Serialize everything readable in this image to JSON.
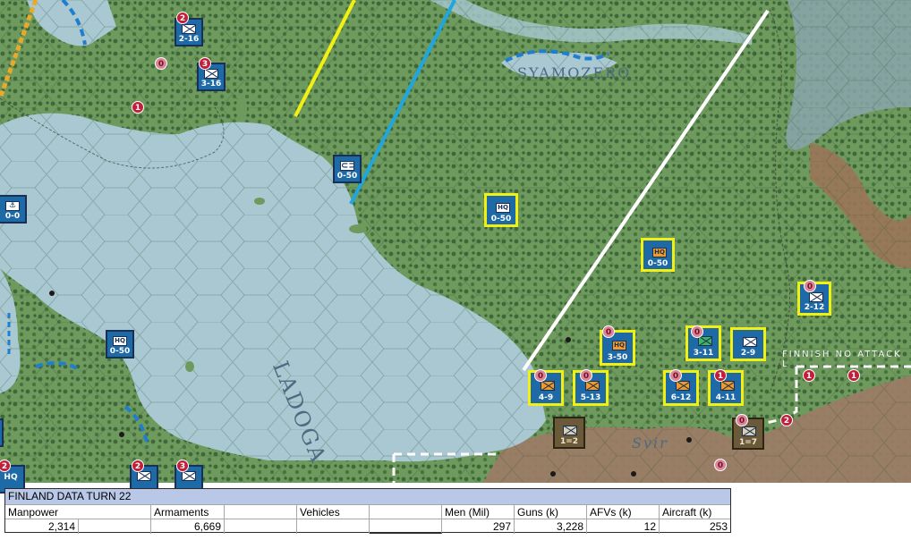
{
  "map": {
    "labels": {
      "lake": "LADOGA",
      "town": "SYAMOZERO",
      "river": "Svir",
      "zone": "FINNISH NO ATTACK L"
    },
    "colors": {
      "land": "#5f8f52",
      "forest": "#3e6d3a",
      "water": "#a9c8d2",
      "hills": "#9a7658",
      "front_yellow": "#f2ef12",
      "front_blue": "#1ea6e0",
      "front_white": "#ffffff",
      "selection": "#f2ef12"
    },
    "units": [
      {
        "id": "u1",
        "code": "2-16",
        "badge": "2",
        "symbol": "infantry",
        "side": "soviet"
      },
      {
        "id": "u2",
        "code": "3-16",
        "badge": "3",
        "symbol": "infantry",
        "side": "soviet"
      },
      {
        "id": "u3",
        "code": "0-50",
        "badge": "",
        "symbol": "armor",
        "side": "soviet"
      },
      {
        "id": "u4",
        "code": "0-0",
        "badge": "",
        "symbol": "naval",
        "side": "soviet"
      },
      {
        "id": "u5",
        "code": "0-50",
        "badge": "",
        "symbol": "hq",
        "side": "soviet"
      },
      {
        "id": "u6",
        "code": "0-50",
        "badge": "",
        "symbol": "hq",
        "side": "soviet",
        "selected": true
      },
      {
        "id": "u7",
        "code": "0-50",
        "badge": "",
        "symbol": "hq-orange",
        "side": "soviet",
        "selected": true
      },
      {
        "id": "u8",
        "code": "2-12",
        "badge": "0",
        "symbol": "infantry",
        "side": "soviet",
        "selected": true
      },
      {
        "id": "u9",
        "code": "3-50",
        "badge": "0",
        "symbol": "hq-orange",
        "side": "soviet",
        "selected": true
      },
      {
        "id": "u10",
        "code": "3-11",
        "badge": "0",
        "symbol": "infantry-green",
        "side": "soviet",
        "selected": true
      },
      {
        "id": "u11",
        "code": "2-9",
        "badge": "",
        "symbol": "infantry",
        "side": "soviet",
        "selected": true
      },
      {
        "id": "u12",
        "code": "4-9",
        "badge": "0",
        "symbol": "infantry-orange",
        "side": "soviet",
        "selected": true
      },
      {
        "id": "u13",
        "code": "5-13",
        "badge": "0",
        "symbol": "infantry-orange",
        "side": "soviet",
        "selected": true
      },
      {
        "id": "u14",
        "code": "6-12",
        "badge": "0",
        "symbol": "infantry-orange",
        "side": "soviet",
        "selected": true
      },
      {
        "id": "u15",
        "code": "4-11",
        "badge": "1",
        "symbol": "infantry-orange",
        "side": "soviet",
        "selected": true
      },
      {
        "id": "u16",
        "code": "1=2",
        "badge": "",
        "symbol": "infantry",
        "side": "finnish"
      },
      {
        "id": "u17",
        "code": "1=7",
        "badge": "0",
        "symbol": "infantry",
        "side": "finnish"
      },
      {
        "id": "u18",
        "code": "",
        "badge": "2",
        "symbol": "infantry",
        "side": "soviet"
      },
      {
        "id": "u19",
        "code": "",
        "badge": "3",
        "symbol": "infantry",
        "side": "soviet"
      },
      {
        "id": "u20",
        "code": "HQ",
        "badge": "2",
        "symbol": "hq",
        "side": "soviet"
      }
    ],
    "free_badges": [
      "0",
      "1",
      "1",
      "1",
      "2",
      "0"
    ]
  },
  "panel": {
    "title": "FINLAND DATA TURN 22",
    "manpower_label": "Manpower",
    "manpower_value": "2,314",
    "armaments_label": "Armaments",
    "armaments_value": "6,669",
    "vehicles_label": "Vehicles",
    "vehicles_value": "",
    "men_label": "Men (Mil)",
    "men_value": "297",
    "guns_label": "Guns (k)",
    "guns_value": "3,228",
    "afvs_label": "AFVs (k)",
    "afvs_value": "12",
    "aircraft_label": "Aircraft (k)",
    "aircraft_value": "253"
  }
}
